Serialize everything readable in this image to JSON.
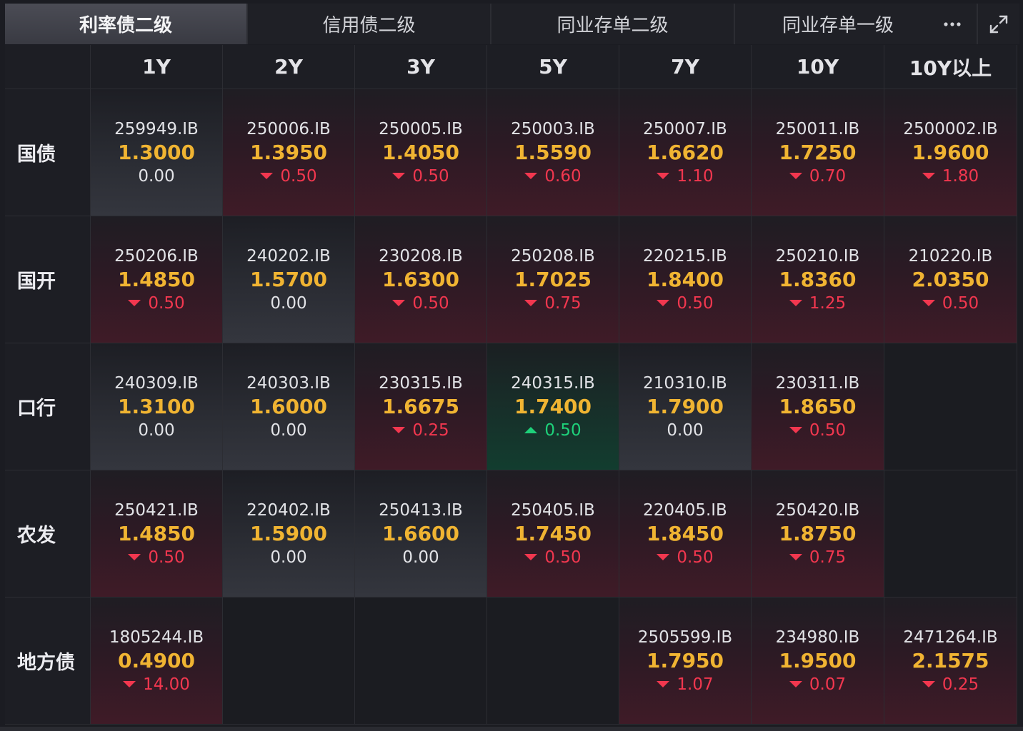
{
  "tabs": [
    {
      "label": "利率债二级",
      "active": true
    },
    {
      "label": "信用债二级",
      "active": false
    },
    {
      "label": "同业存单二级",
      "active": false
    },
    {
      "label": "同业存单一级",
      "active": false
    }
  ],
  "toolbar": {
    "more_icon": "more-icon",
    "expand_icon": "expand-icon"
  },
  "columns": [
    "1Y",
    "2Y",
    "3Y",
    "5Y",
    "7Y",
    "10Y",
    "10Y以上"
  ],
  "rows": [
    {
      "label": "国债",
      "cells": [
        {
          "code": "259949.IB",
          "yield": "1.3000",
          "change": "0.00",
          "dir": "flat"
        },
        {
          "code": "250006.IB",
          "yield": "1.3950",
          "change": "0.50",
          "dir": "down"
        },
        {
          "code": "250005.IB",
          "yield": "1.4050",
          "change": "0.50",
          "dir": "down"
        },
        {
          "code": "250003.IB",
          "yield": "1.5590",
          "change": "0.60",
          "dir": "down"
        },
        {
          "code": "250007.IB",
          "yield": "1.6620",
          "change": "1.10",
          "dir": "down"
        },
        {
          "code": "250011.IB",
          "yield": "1.7250",
          "change": "0.70",
          "dir": "down"
        },
        {
          "code": "2500002.IB",
          "yield": "1.9600",
          "change": "1.80",
          "dir": "down"
        }
      ]
    },
    {
      "label": "国开",
      "cells": [
        {
          "code": "250206.IB",
          "yield": "1.4850",
          "change": "0.50",
          "dir": "down"
        },
        {
          "code": "240202.IB",
          "yield": "1.5700",
          "change": "0.00",
          "dir": "flat"
        },
        {
          "code": "230208.IB",
          "yield": "1.6300",
          "change": "0.50",
          "dir": "down"
        },
        {
          "code": "250208.IB",
          "yield": "1.7025",
          "change": "0.75",
          "dir": "down"
        },
        {
          "code": "220215.IB",
          "yield": "1.8400",
          "change": "0.50",
          "dir": "down"
        },
        {
          "code": "250210.IB",
          "yield": "1.8360",
          "change": "1.25",
          "dir": "down"
        },
        {
          "code": "210220.IB",
          "yield": "2.0350",
          "change": "0.50",
          "dir": "down"
        }
      ]
    },
    {
      "label": "口行",
      "cells": [
        {
          "code": "240309.IB",
          "yield": "1.3100",
          "change": "0.00",
          "dir": "flat"
        },
        {
          "code": "240303.IB",
          "yield": "1.6000",
          "change": "0.00",
          "dir": "flat"
        },
        {
          "code": "230315.IB",
          "yield": "1.6675",
          "change": "0.25",
          "dir": "down"
        },
        {
          "code": "240315.IB",
          "yield": "1.7400",
          "change": "0.50",
          "dir": "up"
        },
        {
          "code": "210310.IB",
          "yield": "1.7900",
          "change": "0.00",
          "dir": "flat"
        },
        {
          "code": "230311.IB",
          "yield": "1.8650",
          "change": "0.50",
          "dir": "down"
        },
        null
      ]
    },
    {
      "label": "农发",
      "cells": [
        {
          "code": "250421.IB",
          "yield": "1.4850",
          "change": "0.50",
          "dir": "down"
        },
        {
          "code": "220402.IB",
          "yield": "1.5900",
          "change": "0.00",
          "dir": "flat"
        },
        {
          "code": "250413.IB",
          "yield": "1.6600",
          "change": "0.00",
          "dir": "flat"
        },
        {
          "code": "250405.IB",
          "yield": "1.7450",
          "change": "0.50",
          "dir": "down"
        },
        {
          "code": "220405.IB",
          "yield": "1.8450",
          "change": "0.50",
          "dir": "down"
        },
        {
          "code": "250420.IB",
          "yield": "1.8750",
          "change": "0.75",
          "dir": "down"
        },
        null
      ]
    },
    {
      "label": "地方债",
      "cells": [
        {
          "code": "1805244.IB",
          "yield": "0.4900",
          "change": "14.00",
          "dir": "down"
        },
        null,
        null,
        null,
        {
          "code": "2505599.IB",
          "yield": "1.7950",
          "change": "1.07",
          "dir": "down"
        },
        {
          "code": "234980.IB",
          "yield": "1.9500",
          "change": "0.07",
          "dir": "down"
        },
        {
          "code": "2471264.IB",
          "yield": "2.1575",
          "change": "0.25",
          "dir": "down"
        }
      ]
    }
  ],
  "colors": {
    "yield": "#f0b432",
    "down": "#f2374f",
    "up": "#1ed17a",
    "flat": "#e2e3e7"
  }
}
